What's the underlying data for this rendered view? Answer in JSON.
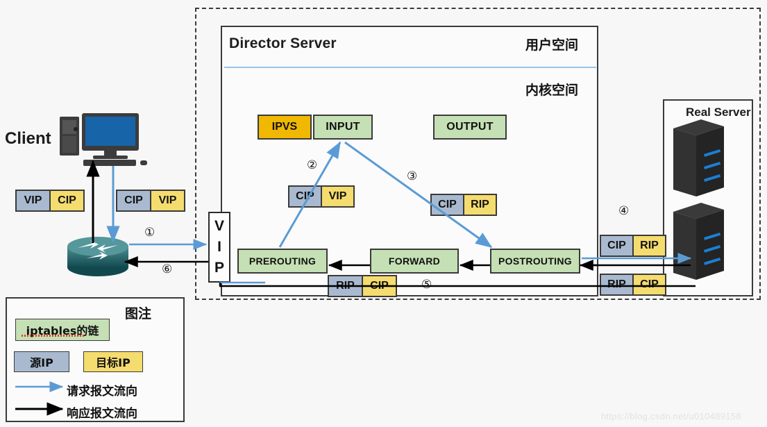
{
  "diagram": {
    "title_director": "Director Server",
    "title_realserver": "Real Server",
    "label_client": "Client",
    "label_userspace": "用户空间",
    "label_kernelspace": "内核空间"
  },
  "chains": {
    "ipvs": "IPVS",
    "input": "INPUT",
    "output": "OUTPUT",
    "prerouting": "PREROUTING",
    "forward": "FORWARD",
    "postrouting": "POSTROUTING"
  },
  "vip_interface": {
    "l1": "V",
    "l2": "I",
    "l3": "P"
  },
  "packets": {
    "client_resp": {
      "src": "VIP",
      "dst": "CIP"
    },
    "client_req": {
      "src": "CIP",
      "dst": "VIP"
    },
    "prerouting_req": {
      "src": "CIP",
      "dst": "VIP"
    },
    "postrouting_req": {
      "src": "CIP",
      "dst": "RIP"
    },
    "rs_in": {
      "src": "CIP",
      "dst": "RIP"
    },
    "rs_out": {
      "src": "RIP",
      "dst": "CIP"
    },
    "resp_chain": {
      "src": "RIP",
      "dst": "CIP"
    }
  },
  "steps": {
    "s1": "①",
    "s2": "②",
    "s3": "③",
    "s4": "④",
    "s5": "⑤",
    "s6": "⑥"
  },
  "legend": {
    "title": "图注",
    "chain_label": "iptables的链",
    "src_label": "源IP",
    "dst_label": "目标IP",
    "request_flow": "请求报文流向",
    "response_flow": "响应报文流向"
  },
  "watermark": "https://blog.csdn.net/u010489158",
  "colors": {
    "chain_green": "#c5e0b4",
    "ipvs_amber": "#f0b800",
    "src_gray": "#a9bad0",
    "dst_yellow": "#f5dc6e",
    "request_blue": "#5b9bd5",
    "response_black": "#000000",
    "divider_blue": "#9cc3e5"
  }
}
